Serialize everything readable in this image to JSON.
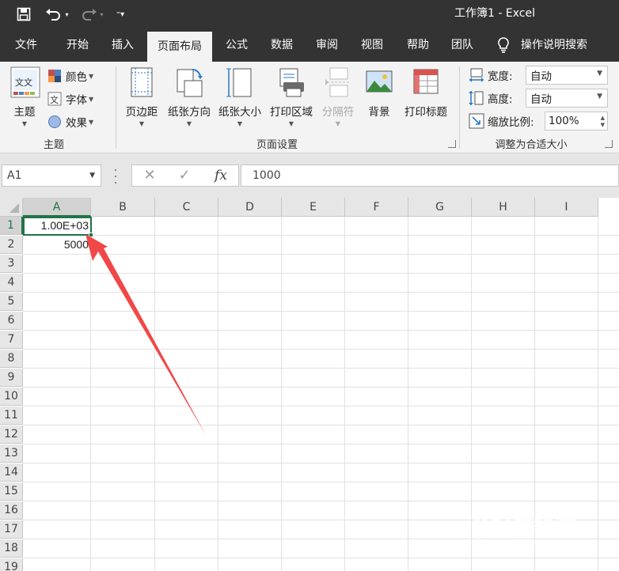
{
  "titlebar": {
    "title": "工作簿1  -  Excel"
  },
  "ribbon_tabs": [
    {
      "label": "文件"
    },
    {
      "label": "开始"
    },
    {
      "label": "插入"
    },
    {
      "label": "页面布局"
    },
    {
      "label": "公式"
    },
    {
      "label": "数据"
    },
    {
      "label": "审阅"
    },
    {
      "label": "视图"
    },
    {
      "label": "帮助"
    },
    {
      "label": "团队"
    }
  ],
  "tell_me": "操作说明搜索",
  "themes_group": {
    "label": "主题",
    "themes_button": "主题",
    "colors": "颜色",
    "fonts": "字体",
    "effects": "效果",
    "theme_icon_text": "文文"
  },
  "page_setup_group": {
    "label": "页面设置",
    "margins": "页边距",
    "orientation": "纸张方向",
    "size": "纸张大小",
    "print_area": "打印区域",
    "breaks": "分隔符",
    "background": "背景",
    "print_titles": "打印标题"
  },
  "scale_group": {
    "label": "调整为合适大小",
    "width_label": "宽度:",
    "width_value": "自动",
    "height_label": "高度:",
    "height_value": "自动",
    "scale_label": "缩放比例:",
    "scale_value": "100%"
  },
  "formula_bar": {
    "name_box": "A1",
    "fx": "fx",
    "value": "1000"
  },
  "columns": [
    "A",
    "B",
    "C",
    "D",
    "E",
    "F",
    "G",
    "H",
    "I"
  ],
  "rows": [
    "1",
    "2",
    "3",
    "4",
    "5",
    "6",
    "7",
    "8",
    "9",
    "10",
    "11",
    "12",
    "13",
    "14",
    "15",
    "16",
    "17",
    "18",
    "19"
  ],
  "cells": {
    "A1": "1.00E+03",
    "A2": "5000"
  },
  "colors": {
    "titlebar": "#333333",
    "ribbon": "#f3f3f3",
    "excel_green": "#217346",
    "annotation_arrow": "#f04848"
  },
  "watermark": {
    "brand": "Bai度经验",
    "url": "jingyan.baidu.com"
  }
}
